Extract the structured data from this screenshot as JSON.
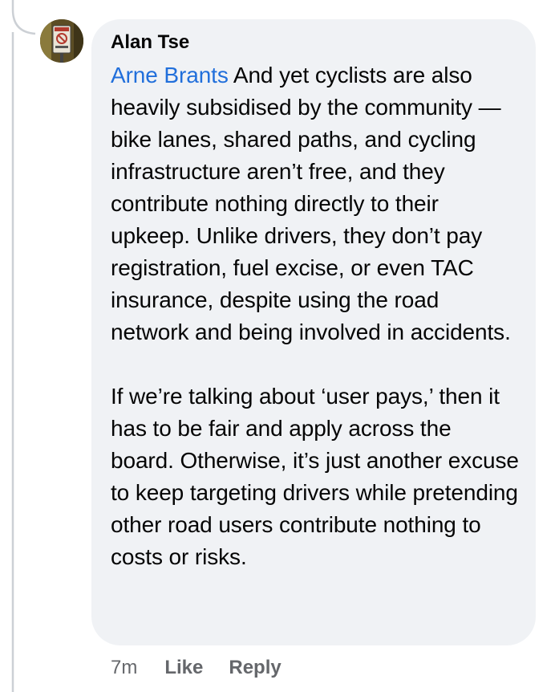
{
  "comment": {
    "author": "Alan Tse",
    "mention": "Arne Brants",
    "paragraph1_rest": " And yet cyclists are also heavily subsidised by the community —bike lanes, shared paths, and cycling infrastructure aren’t free, and they contribute nothing directly to their upkeep. Unlike drivers, they don’t pay registration, fuel excise, or even TAC insurance, despite using the road network and being involved in accidents.",
    "paragraph2": "If we’re talking about ‘user pays,’ then it has to be fair and apply across the board. Otherwise, it’s just another excuse to keep targeting drivers while pretending other road users contribute nothing to costs or risks.",
    "timestamp": "7m",
    "like_label": "Like",
    "reply_label": "Reply"
  },
  "colors": {
    "bubble_bg": "#f0f2f5",
    "text": "#050505",
    "mention": "#216fdb",
    "meta": "#65676b",
    "thread_line": "#ccd0d5"
  },
  "icons": {
    "avatar": "profile-photo-sign-icon"
  }
}
